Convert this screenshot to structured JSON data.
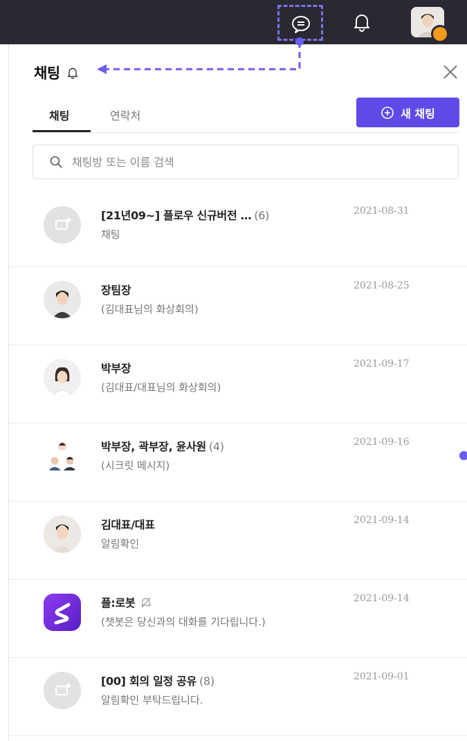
{
  "header": {
    "icons": [
      "chat-bubble-icon",
      "bell-icon",
      "profile-avatar"
    ],
    "accent_dot_color": "#f39a1c",
    "annotation_color": "#7b74e8"
  },
  "panel": {
    "title": "채팅",
    "tabs": [
      {
        "label": "채팅",
        "active": true
      },
      {
        "label": "연락처",
        "active": false
      }
    ],
    "new_chat_label": "새 채팅",
    "new_chat_color": "#5f4ae8",
    "search_placeholder": "채팅방 또는 이름 검색"
  },
  "chats": [
    {
      "name": "[21년09~] 플로우 신규버전 …",
      "count": "(6)",
      "preview": "채팅",
      "date": "2021-08-31",
      "avatar": "group-placeholder"
    },
    {
      "name": "장팀장",
      "count": "",
      "preview": "(김대표님의 화상회의)",
      "date": "2021-08-25",
      "avatar": "person-photo"
    },
    {
      "name": "박부장",
      "count": "",
      "preview": "(김대표/대표님의 화상회의)",
      "date": "2021-09-17",
      "avatar": "person-photo"
    },
    {
      "name": "박부장, 곽부장, 윤사원",
      "count": "(4)",
      "preview": "(시크릿 메시지)",
      "date": "2021-09-16",
      "avatar": "multi-person"
    },
    {
      "name": "김대표/대표",
      "count": "",
      "preview": "알림확인",
      "date": "2021-09-14",
      "avatar": "person-photo"
    },
    {
      "name": "플:로봇",
      "count": "",
      "preview": "(챗봇은 당신과의 대화를 기다립니다.)",
      "date": "2021-09-14",
      "avatar": "bot-logo",
      "muted": true
    },
    {
      "name": "[00] 회의 일정 공유",
      "count": "(8)",
      "preview": "알림확인 부탁드립니다.",
      "date": "2021-09-01",
      "avatar": "group-placeholder"
    }
  ]
}
